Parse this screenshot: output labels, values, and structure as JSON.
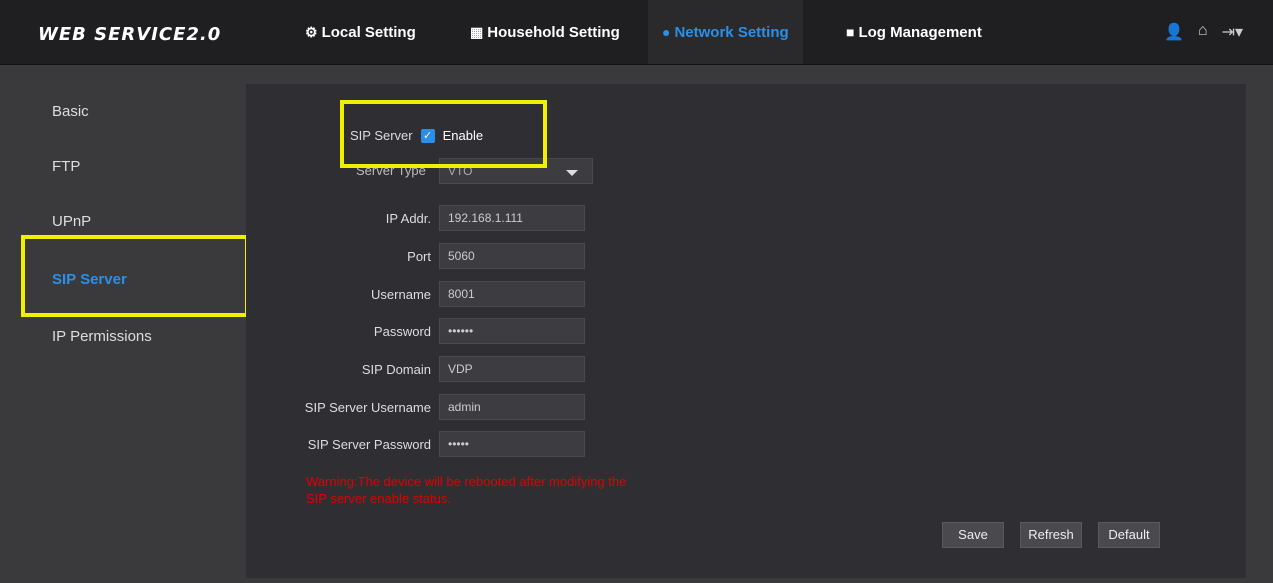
{
  "app_title": "WEB SERVICE2.0",
  "nav": {
    "local": "Local Setting",
    "household": "Household Setting",
    "network": "Network Setting",
    "log": "Log Management"
  },
  "sidebar": {
    "items": [
      {
        "label": "Basic"
      },
      {
        "label": "FTP"
      },
      {
        "label": "UPnP"
      },
      {
        "label": "SIP Server"
      },
      {
        "label": "IP Permissions"
      }
    ]
  },
  "form": {
    "sip_server_label": "SIP Server",
    "enable_label": "Enable",
    "server_type_label": "Server Type",
    "server_type_value": "VTO",
    "fields": [
      {
        "label": "IP Addr.",
        "value": "192.168.1.111"
      },
      {
        "label": "Port",
        "value": "5060"
      },
      {
        "label": "Username",
        "value": "8001"
      },
      {
        "label": "Password",
        "value": "••••••"
      },
      {
        "label": "SIP Domain",
        "value": "VDP"
      },
      {
        "label": "SIP Server Username",
        "value": "admin"
      },
      {
        "label": "SIP Server Password",
        "value": "•••••"
      }
    ],
    "warning": "Warning:The device will be rebooted after modifying the SIP server enable status."
  },
  "buttons": {
    "save": "Save",
    "refresh": "Refresh",
    "default": "Default"
  },
  "colors": {
    "accent": "#2b8fe8",
    "highlight": "#f0f000",
    "warning": "#e00000"
  }
}
